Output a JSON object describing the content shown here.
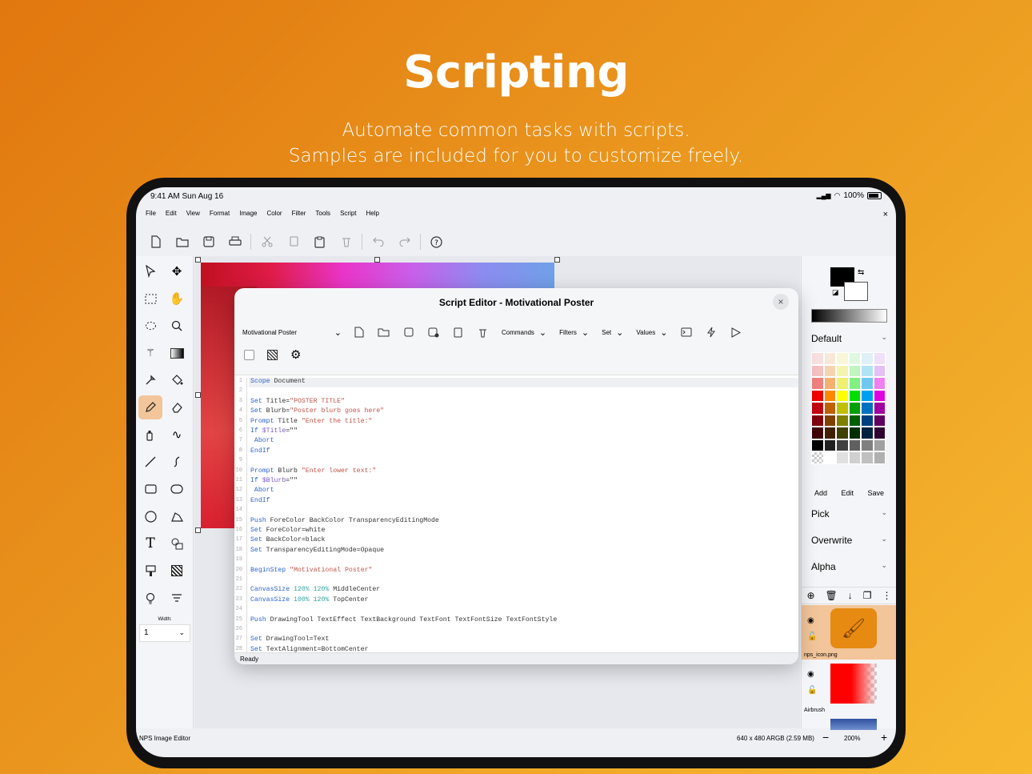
{
  "hero": {
    "title": "Scripting",
    "line1": "Automate common tasks with scripts.",
    "line2": "Samples are included for you to customize freely."
  },
  "status_bar": {
    "time": "9:41 AM  Sun Aug 16",
    "battery": "100%"
  },
  "menu": [
    "File",
    "Edit",
    "View",
    "Format",
    "Image",
    "Color",
    "Filter",
    "Tools",
    "Script",
    "Help"
  ],
  "close_icon": "×",
  "width": {
    "label": "Width:",
    "value": "1"
  },
  "right_panel": {
    "palette_name": "Default",
    "add": "Add",
    "edit": "Edit",
    "save": "Save",
    "pick": "Pick",
    "overwrite": "Overwrite",
    "alpha": "Alpha"
  },
  "layers": [
    {
      "name": "nps_icon.png"
    },
    {
      "name": "Airbrush"
    }
  ],
  "footer": {
    "app_name": "NPS Image Editor",
    "info": "640 x 480 ARGB (2.59 MB)",
    "zoom": "200%"
  },
  "editor": {
    "title": "Script Editor - Motivational Poster",
    "script_select": "Motivational Poster",
    "commands": "Commands",
    "filters": "Filters",
    "set": "Set",
    "values": "Values",
    "status": "Ready"
  },
  "colors": {
    "accent": "#f2c59a"
  }
}
